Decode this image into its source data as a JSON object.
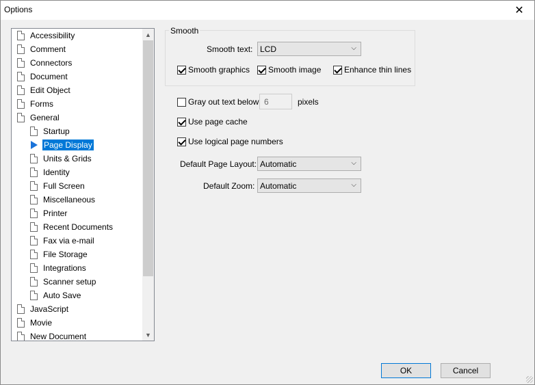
{
  "window": {
    "title": "Options",
    "close_glyph": "✕"
  },
  "tree": {
    "items": [
      {
        "label": "Accessibility",
        "level": 0,
        "selected": false
      },
      {
        "label": "Comment",
        "level": 0,
        "selected": false
      },
      {
        "label": "Connectors",
        "level": 0,
        "selected": false
      },
      {
        "label": "Document",
        "level": 0,
        "selected": false
      },
      {
        "label": "Edit Object",
        "level": 0,
        "selected": false
      },
      {
        "label": "Forms",
        "level": 0,
        "selected": false
      },
      {
        "label": "General",
        "level": 0,
        "selected": false
      },
      {
        "label": "Startup",
        "level": 1,
        "selected": false
      },
      {
        "label": "Page Display",
        "level": 1,
        "selected": true
      },
      {
        "label": "Units & Grids",
        "level": 1,
        "selected": false
      },
      {
        "label": "Identity",
        "level": 1,
        "selected": false
      },
      {
        "label": "Full Screen",
        "level": 1,
        "selected": false
      },
      {
        "label": "Miscellaneous",
        "level": 1,
        "selected": false
      },
      {
        "label": "Printer",
        "level": 1,
        "selected": false
      },
      {
        "label": "Recent Documents",
        "level": 1,
        "selected": false
      },
      {
        "label": "Fax via e-mail",
        "level": 1,
        "selected": false
      },
      {
        "label": "File Storage",
        "level": 1,
        "selected": false
      },
      {
        "label": "Integrations",
        "level": 1,
        "selected": false
      },
      {
        "label": "Scanner setup",
        "level": 1,
        "selected": false
      },
      {
        "label": "Auto Save",
        "level": 1,
        "selected": false
      },
      {
        "label": "JavaScript",
        "level": 0,
        "selected": false
      },
      {
        "label": "Movie",
        "level": 0,
        "selected": false
      },
      {
        "label": "New Document",
        "level": 0,
        "selected": false
      }
    ],
    "scroll_up_glyph": "▲",
    "scroll_down_glyph": "▼"
  },
  "smooth": {
    "group_title": "Smooth",
    "text_label": "Smooth text:",
    "text_value": "LCD",
    "graphics_label": "Smooth graphics",
    "graphics_checked": true,
    "image_label": "Smooth image",
    "image_checked": true,
    "thin_lines_label": "Enhance thin lines",
    "thin_lines_checked": true
  },
  "gray_out": {
    "label": "Gray out text below",
    "checked": false,
    "value": "6",
    "unit": "pixels"
  },
  "page_cache": {
    "label": "Use page cache",
    "checked": true
  },
  "logical_numbers": {
    "label": "Use logical page numbers",
    "checked": true
  },
  "layout": {
    "label": "Default Page Layout:",
    "value": "Automatic"
  },
  "zoom": {
    "label": "Default Zoom:",
    "value": "Automatic"
  },
  "dropdown_glyph": "⌵",
  "buttons": {
    "ok": "OK",
    "cancel": "Cancel"
  },
  "colors": {
    "selection": "#0078d7",
    "accent_arrow": "#1a73d9"
  }
}
